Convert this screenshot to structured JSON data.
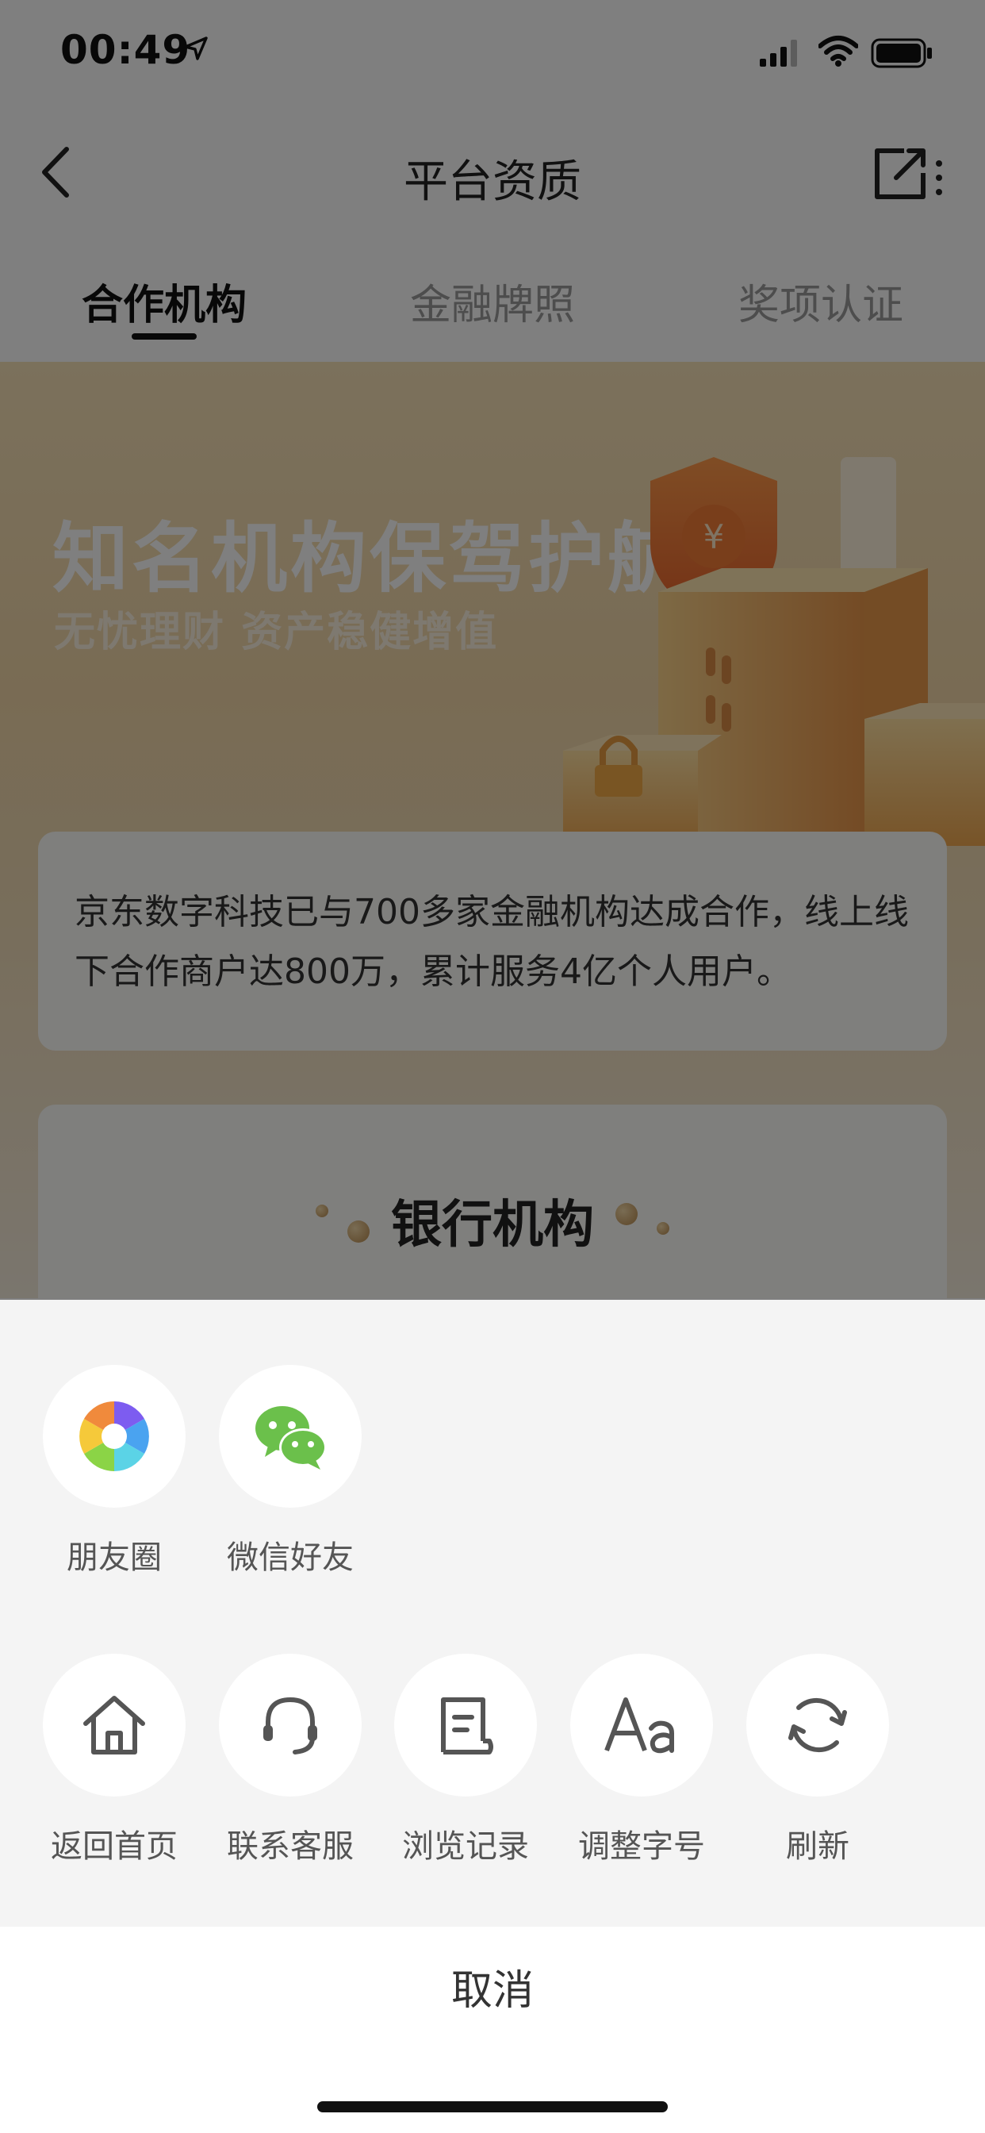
{
  "status_bar": {
    "time": "00:49"
  },
  "nav": {
    "title": "平台资质"
  },
  "tabs": [
    {
      "label": "合作机构",
      "active": true
    },
    {
      "label": "金融牌照",
      "active": false
    },
    {
      "label": "奖项认证",
      "active": false
    }
  ],
  "banner": {
    "title": "知名机构保驾护航",
    "subtitle": "无忧理财 资产稳健增值"
  },
  "info_card": {
    "text": "京东数字科技已与700多家金融机构达成合作，线上线下合作商户达800万，累计服务4亿个人用户。"
  },
  "bank_section": {
    "title": "银行机构"
  },
  "share_sheet": {
    "share_targets": [
      {
        "label": "朋友圈",
        "icon": "moments-icon"
      },
      {
        "label": "微信好友",
        "icon": "wechat-icon"
      }
    ],
    "actions": [
      {
        "label": "返回首页",
        "icon": "home-icon"
      },
      {
        "label": "联系客服",
        "icon": "headset-icon"
      },
      {
        "label": "浏览记录",
        "icon": "history-icon"
      },
      {
        "label": "调整字号",
        "icon": "font-size-icon"
      },
      {
        "label": "刷新",
        "icon": "refresh-icon"
      }
    ],
    "cancel_label": "取消"
  },
  "colors": {
    "overlay": "#000000",
    "banner_gold": "#f2d7a8",
    "wechat_green": "#6bc04b"
  }
}
